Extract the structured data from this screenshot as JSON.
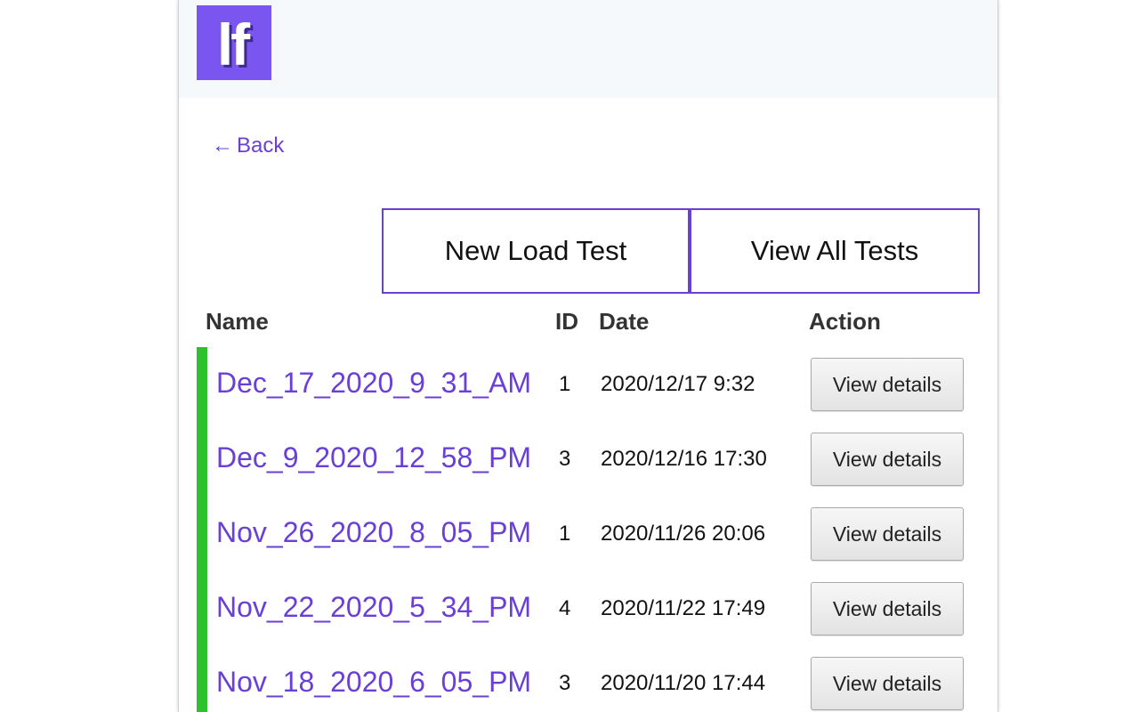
{
  "logo": {
    "text": "lf"
  },
  "nav": {
    "back_arrow": "←",
    "back_label": "Back"
  },
  "actions": {
    "new_load_test": "New Load Test",
    "view_all_tests": "View All Tests"
  },
  "table": {
    "headers": {
      "name": "Name",
      "id": "ID",
      "date": "Date",
      "action": "Action"
    },
    "rows": [
      {
        "name": "Dec_17_2020_9_31_AM",
        "id": "1",
        "date": "2020/12/17 9:32",
        "action": "View details",
        "status_color": "#2ec12e"
      },
      {
        "name": "Dec_9_2020_12_58_PM",
        "id": "3",
        "date": "2020/12/16 17:30",
        "action": "View details",
        "status_color": "#2ec12e"
      },
      {
        "name": "Nov_26_2020_8_05_PM",
        "id": "1",
        "date": "2020/11/26 20:06",
        "action": "View details",
        "status_color": "#2ec12e"
      },
      {
        "name": "Nov_22_2020_5_34_PM",
        "id": "4",
        "date": "2020/11/22 17:49",
        "action": "View details",
        "status_color": "#2ec12e"
      },
      {
        "name": "Nov_18_2020_6_05_PM",
        "id": "3",
        "date": "2020/11/20 17:44",
        "action": "View details",
        "status_color": "#2ec12e"
      }
    ]
  },
  "colors": {
    "accent": "#6a3fd6",
    "logo_bg": "#7b55f0",
    "status_ok": "#2ec12e",
    "header_bg": "#f5f9fc"
  }
}
